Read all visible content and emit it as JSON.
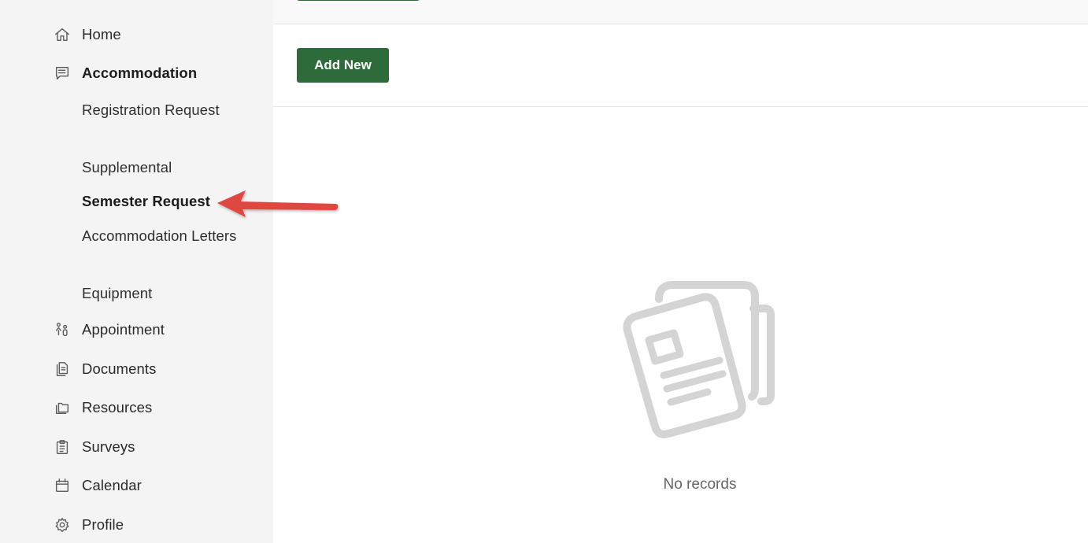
{
  "sidebar": {
    "items": [
      {
        "label": "Home",
        "icon": "home-icon"
      },
      {
        "label": "Accommodation",
        "icon": "list-icon",
        "active": true,
        "children": [
          {
            "label": "Registration Request"
          },
          {
            "label": "Supplemental"
          },
          {
            "label": "Semester Request",
            "active": true
          },
          {
            "label": "Accommodation Letters"
          },
          {
            "label": "Equipment"
          }
        ]
      },
      {
        "label": "Appointment",
        "icon": "people-icon"
      },
      {
        "label": "Documents",
        "icon": "documents-icon"
      },
      {
        "label": "Resources",
        "icon": "folder-icon"
      },
      {
        "label": "Surveys",
        "icon": "clipboard-icon"
      },
      {
        "label": "Calendar",
        "icon": "calendar-icon"
      },
      {
        "label": "Profile",
        "icon": "gear-icon"
      }
    ]
  },
  "toolbar": {
    "add_label": "Add New"
  },
  "main": {
    "empty_text": "No records",
    "empty_icon": "documents-illustration-icon"
  },
  "colors": {
    "accent": "#2e6b3a",
    "arrow": "#e0463f",
    "sidebar_bg": "#f4f4f4"
  }
}
